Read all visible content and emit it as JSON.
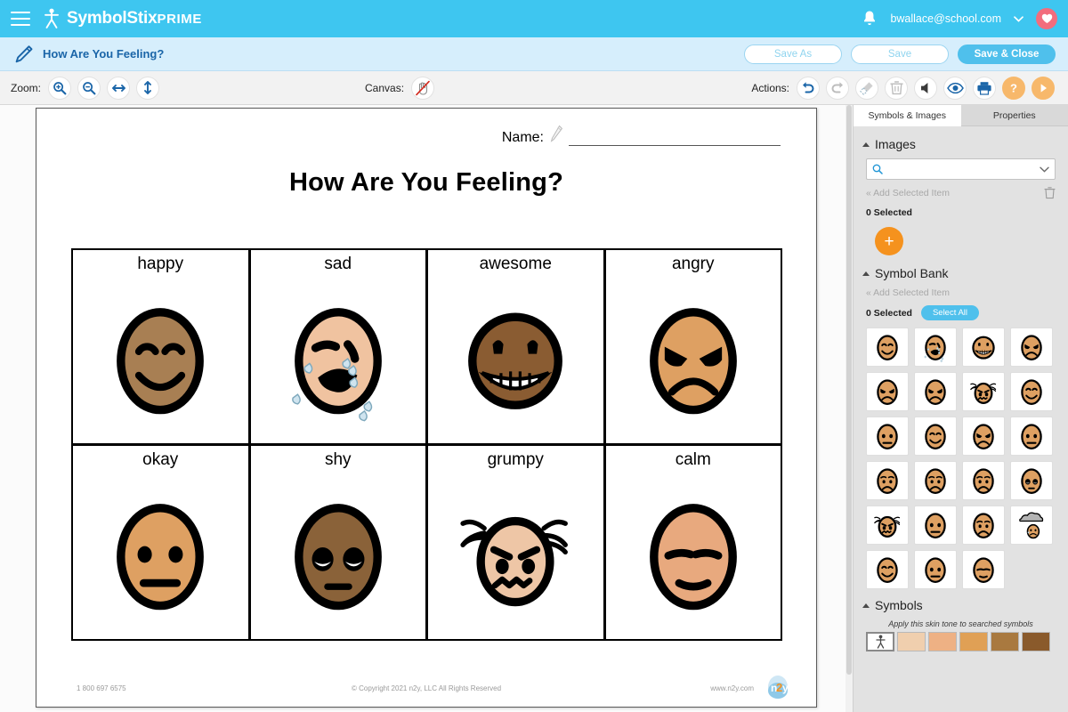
{
  "topbar": {
    "menu_icon": "hamburger-icon",
    "brand_name": "SymbolStix",
    "brand_suffix": "PRIME",
    "notification_icon": "bell-icon",
    "account_email": "bwallace@school.com",
    "account_caret": "chevron-down-icon",
    "favorites_icon": "heart-icon"
  },
  "docbar": {
    "edit_icon": "pencil-icon",
    "document_title": "How Are You Feeling?",
    "save_as_label": "Save As",
    "save_label": "Save",
    "save_close_label": "Save & Close"
  },
  "toolbar": {
    "zoom_label": "Zoom:",
    "zoom_buttons": [
      {
        "name": "zoom-in-icon",
        "enabled": true
      },
      {
        "name": "zoom-out-icon",
        "enabled": true
      },
      {
        "name": "fit-width-icon",
        "enabled": true
      },
      {
        "name": "fit-height-icon",
        "enabled": true
      }
    ],
    "canvas_label": "Canvas:",
    "canvas_buttons": [
      {
        "name": "pan-hand-disabled-icon",
        "enabled": false
      }
    ],
    "actions_label": "Actions:",
    "action_buttons": [
      {
        "name": "undo-icon",
        "enabled": true
      },
      {
        "name": "redo-icon",
        "enabled": false
      },
      {
        "name": "clear-broom-icon",
        "enabled": false
      },
      {
        "name": "delete-trash-icon",
        "enabled": false
      },
      {
        "name": "speaker-icon",
        "enabled": true
      },
      {
        "name": "preview-eye-icon",
        "enabled": true
      },
      {
        "name": "print-icon",
        "enabled": true
      },
      {
        "name": "help-icon",
        "enabled": true
      },
      {
        "name": "play-icon",
        "enabled": true
      }
    ]
  },
  "document": {
    "name_label": "Name:",
    "name_value": "",
    "name_pencil_icon": "pencil-outline-icon",
    "title": "How Are You Feeling?",
    "cards": [
      {
        "label": "happy",
        "art": "happy",
        "skin": "#a87f53"
      },
      {
        "label": "sad",
        "art": "sad",
        "skin": "#f0c3a0"
      },
      {
        "label": "awesome",
        "art": "awesome",
        "skin": "#8a5c32"
      },
      {
        "label": "angry",
        "art": "angry",
        "skin": "#dea062"
      },
      {
        "label": "okay",
        "art": "okay",
        "skin": "#dea062"
      },
      {
        "label": "shy",
        "art": "shy",
        "skin": "#8a6239"
      },
      {
        "label": "grumpy",
        "art": "grumpy",
        "skin": "#eec6a6"
      },
      {
        "label": "calm",
        "art": "calm",
        "skin": "#e8a97e"
      }
    ],
    "footer_phone": "1 800 697 6575",
    "footer_copyright": "© Copyright 2021 n2y, LLC All Rights Reserved",
    "footer_web": "www.n2y.com",
    "footer_logo": "n2y-logo"
  },
  "panel": {
    "tabs": [
      {
        "label": "Symbols & Images",
        "active": true
      },
      {
        "label": "Properties",
        "active": false
      }
    ],
    "images": {
      "heading": "Images",
      "search_placeholder": "",
      "search_value": "",
      "search_icon": "search-icon",
      "dropdown_icon": "chevron-down-icon",
      "add_selected_label": "« Add Selected Item",
      "trash_icon": "trash-icon",
      "selected_count": "0 Selected",
      "add_image_icon": "plus-icon"
    },
    "symbol_bank": {
      "heading": "Symbol Bank",
      "add_selected_label": "« Add Selected Item",
      "selected_count": "0 Selected",
      "select_all_label": "Select All",
      "symbols": [
        "happy",
        "sad",
        "awesome",
        "angry",
        "angry-blush",
        "angry-teeth",
        "furious-hair",
        "smile",
        "flat-brow",
        "sly",
        "angry2",
        "frown-small",
        "worried",
        "worried2",
        "worried3",
        "eyes-up",
        "confused",
        "concerned",
        "sad-small",
        "rain-cloud",
        "smirk",
        "neutral",
        "calm"
      ]
    },
    "symbols_section": {
      "heading": "Symbols",
      "skin_note": "Apply this skin tone to searched symbols",
      "skin_tones": [
        "#ffffff",
        "#f0cfae",
        "#eeb184",
        "#e0a055",
        "#a9793f",
        "#8a5a2b"
      ],
      "first_swatch_icon": "person-figure-icon"
    }
  },
  "colors": {
    "brand_blue": "#3ec6f0",
    "docbar_blue": "#d6eefc",
    "accent_orange": "#f5921e",
    "toolbar_gray": "#f2f2f2",
    "panel_gray": "#e2e2e2"
  }
}
